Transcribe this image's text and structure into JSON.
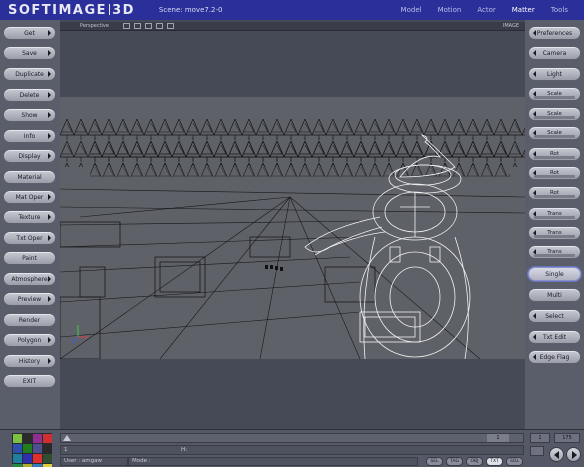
{
  "title_bar": {
    "logo_left": "SOFTIMAGE",
    "logo_right": "3D",
    "scene_label": "Scene: move7.2-0",
    "modules": [
      "Model",
      "Motion",
      "Actor",
      "Matter",
      "Tools"
    ],
    "active_module": "Matter"
  },
  "left_menu": [
    "Get",
    "Save",
    "Duplicate",
    "Delete",
    "Show",
    "Info",
    "Display",
    "Material",
    "Mat Oper",
    "Texture",
    "Txt Oper",
    "Paint",
    "Atmosphere",
    "Preview",
    "Render",
    "Polygon",
    "History",
    "EXIT"
  ],
  "right_menu": {
    "top": [
      "Preferences",
      "Camera",
      "Light"
    ],
    "scale": [
      "Scale",
      "Scale",
      "Scale"
    ],
    "rot": [
      "Rot",
      "Rot",
      "Rot"
    ],
    "trans": [
      "Trans",
      "Trans",
      "Trans"
    ],
    "bottom": [
      "Single",
      "Multi",
      "Select",
      "Txt Edit",
      "Edge Flag"
    ],
    "selected": "Single"
  },
  "viewport": {
    "label": "Perspective",
    "right_label": "IMAGE"
  },
  "timeline": {
    "frame": "1",
    "row2_left": "1",
    "row2_mid": "H:",
    "user_label": "User : amgaw",
    "mode_label": "Mode :",
    "pills": [
      "SEL",
      "TAG",
      "OBJ",
      "TXT",
      "SOL"
    ],
    "active_pill": "TXT",
    "range_start": "1",
    "range_end": "175"
  },
  "palette_colors": [
    "#7fbf3f",
    "#2a2a2a",
    "#8f2f8f",
    "#cf2f2f",
    "#2f4faf",
    "#1f7f1f",
    "#4f4f8f",
    "#2a2a2a",
    "#1f7f9f",
    "#2f2faf",
    "#df2f2f",
    "#2f4f2f",
    "#1f8f3f",
    "#afaf2f",
    "#2f7fbf",
    "#dfcf3f"
  ]
}
